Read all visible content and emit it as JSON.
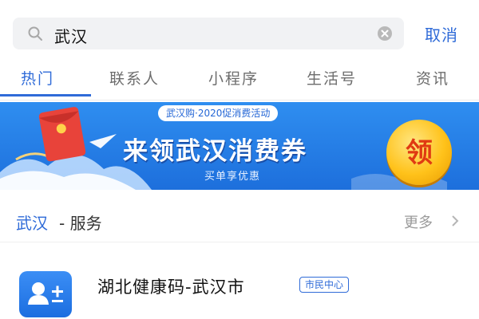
{
  "search": {
    "query": "武汉",
    "cancel_label": "取消"
  },
  "tabs": [
    {
      "label": "热门",
      "active": true
    },
    {
      "label": "联系人",
      "active": false
    },
    {
      "label": "小程序",
      "active": false
    },
    {
      "label": "生活号",
      "active": false
    },
    {
      "label": "资讯",
      "active": false
    }
  ],
  "banner": {
    "badge": "武汉购·2020促消费活动",
    "title": "来领武汉消费券",
    "subtitle": "买单享优惠",
    "coin_text": "领"
  },
  "section": {
    "city": "武汉",
    "label": "- 服务",
    "more_label": "更多"
  },
  "services": [
    {
      "title": "湖北健康码-武汉市",
      "tag": "市民中心",
      "icon": "person-plus-icon"
    }
  ],
  "colors": {
    "accent": "#2f6bd8",
    "banner_blue": "#1d6fdc",
    "coin_yellow": "#ffc21a",
    "coin_text_red": "#e03a12"
  }
}
